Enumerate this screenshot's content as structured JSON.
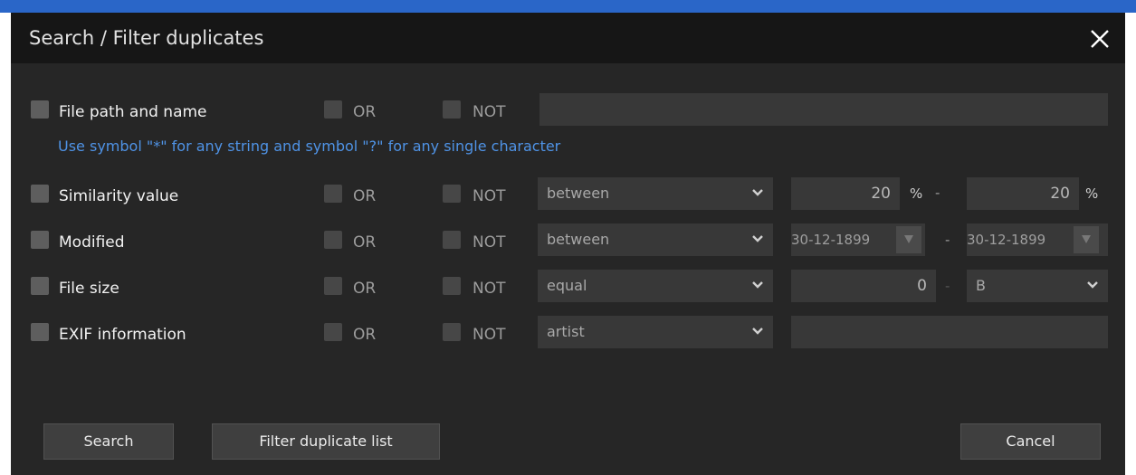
{
  "dialog": {
    "title": "Search / Filter duplicates",
    "close_icon": "close-icon",
    "hint": "Use symbol \"*\" for any string and symbol \"?\" for any single character"
  },
  "ops": {
    "or": "OR",
    "not": "NOT"
  },
  "rows": {
    "path": {
      "label": "File path and name",
      "value": ""
    },
    "similarity": {
      "label": "Similarity value",
      "mode": "between",
      "from": "20",
      "to": "20",
      "unit": "%",
      "sep": "-"
    },
    "modified": {
      "label": "Modified",
      "mode": "between",
      "from": "30-12-1899",
      "to": "30-12-1899",
      "sep": "-"
    },
    "size": {
      "label": "File size",
      "mode": "equal",
      "value": "0",
      "unit": "B",
      "sep": "-"
    },
    "exif": {
      "label": "EXIF information",
      "field": "artist",
      "value": ""
    }
  },
  "buttons": {
    "search": "Search",
    "filter": "Filter duplicate list",
    "cancel": "Cancel"
  },
  "colors": {
    "accent_blue": "#2a66c8",
    "hint_blue": "#4f93e6",
    "background": "#262626",
    "titlebar": "#161616",
    "field": "#383838"
  }
}
